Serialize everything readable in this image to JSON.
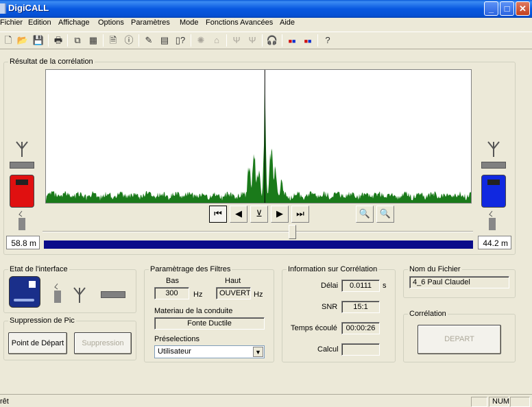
{
  "window": {
    "title": "DigiCALL",
    "min_glyph": "_",
    "max_glyph": "□",
    "close_glyph": "✕"
  },
  "menu": [
    "Fichier",
    "Edition",
    "Affichage",
    "Options",
    "Paramètres",
    "Mode",
    "Fonctions Avancées",
    "Aide"
  ],
  "correlation_panel": {
    "label": "Résultat de la corrélation",
    "left_distance": "58.8 m",
    "right_distance": "44.2 m",
    "slider_value": 0.58,
    "left_sensor_color": "#e01010",
    "right_sensor_color": "#1028e0"
  },
  "chart_data": {
    "type": "area",
    "color": "#1a7a1a",
    "peak_x": 0.515,
    "peak_height": 0.98,
    "secondary": [
      [
        0.478,
        0.34
      ],
      [
        0.49,
        0.45
      ],
      [
        0.5,
        0.32
      ],
      [
        0.53,
        0.48
      ],
      [
        0.54,
        0.34
      ],
      [
        0.555,
        0.2
      ]
    ],
    "noise_level": 0.05,
    "cursor_x": 0.515
  },
  "interface": {
    "label": "Etat de l'interface"
  },
  "pic": {
    "label": "Suppression de Pic",
    "start_button": "Point de Départ",
    "suppress_button": "Suppression"
  },
  "filters": {
    "label": "Paramètrage des Filtres",
    "low_label": "Bas",
    "high_label": "Haut",
    "low_value": "300",
    "high_value": "OUVERT",
    "unit": "Hz",
    "material_label": "Materiau de la conduite",
    "material_value": "Fonte Ductile",
    "preset_label": "Préselections",
    "preset_value": "Utilisateur"
  },
  "info": {
    "label": "Information sur Corrélation",
    "delay_label": "Délai",
    "delay_value": "0.0111",
    "delay_unit": "s",
    "snr_label": "SNR",
    "snr_value": "15:1",
    "elapsed_label": "Temps écoulé",
    "elapsed_value": "00:00:26",
    "calc_label": "Calcul",
    "calc_value": ""
  },
  "file": {
    "label": "Nom du Fichier",
    "value": "4_6 Paul Claudel"
  },
  "correlation": {
    "label": "Corrélation",
    "start_button": "DEPART"
  },
  "status": {
    "left": "rêt",
    "num": "NUM"
  }
}
